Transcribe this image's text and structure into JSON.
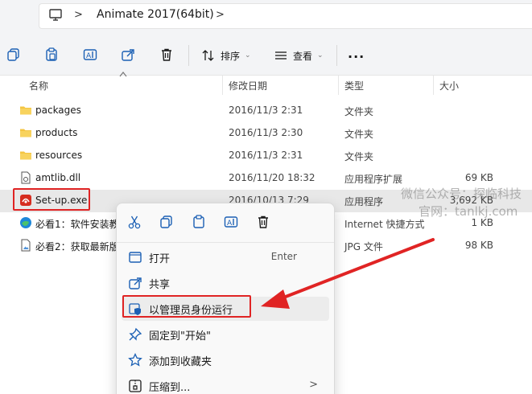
{
  "address": {
    "breadcrumb": "Animate 2017(64bit)",
    "separator": ">"
  },
  "toolbar": {
    "sort_label": "排序",
    "view_label": "查看",
    "more_label": "..."
  },
  "columns": {
    "name": "名称",
    "date": "修改日期",
    "type": "类型",
    "size": "大小"
  },
  "files": [
    {
      "name": "packages",
      "date": "2016/11/3 2:31",
      "type": "文件夹",
      "size": "",
      "icon": "folder-icon"
    },
    {
      "name": "products",
      "date": "2016/11/3 2:30",
      "type": "文件夹",
      "size": "",
      "icon": "folder-icon"
    },
    {
      "name": "resources",
      "date": "2016/11/3 2:31",
      "type": "文件夹",
      "size": "",
      "icon": "folder-icon"
    },
    {
      "name": "amtlib.dll",
      "date": "2016/11/20 18:32",
      "type": "应用程序扩展",
      "size": "69 KB",
      "icon": "dll-file-icon"
    },
    {
      "name": "Set-up.exe",
      "date": "2016/10/13 7:29",
      "type": "应用程序",
      "size": "3,692 KB",
      "icon": "setup-exe-icon"
    },
    {
      "name": "必看1：软件安装教",
      "date": "",
      "type": "Internet 快捷方式",
      "size": "1 KB",
      "icon": "edge-shortcut-icon"
    },
    {
      "name": "必看2：获取最新版",
      "date": "",
      "type": "JPG 文件",
      "size": "98 KB",
      "icon": "image-file-icon"
    }
  ],
  "watermark": {
    "line1": "微信公众号：探临科技",
    "line2": "官网：tanlkj.com"
  },
  "context_menu": {
    "items": [
      {
        "label": "打开",
        "shortcut": "Enter",
        "icon": "open-icon"
      },
      {
        "label": "共享",
        "shortcut": "",
        "icon": "share-icon"
      },
      {
        "label": "以管理员身份运行",
        "shortcut": "",
        "icon": "admin-shield-icon"
      },
      {
        "label": "固定到\"开始\"",
        "shortcut": "",
        "icon": "pin-icon"
      },
      {
        "label": "添加到收藏夹",
        "shortcut": "",
        "icon": "star-icon"
      },
      {
        "label": "压缩到...",
        "shortcut": "",
        "icon": "zip-icon",
        "submenu_arrow": ">"
      }
    ]
  },
  "colors": {
    "highlight": "#e02424",
    "selection": "#e8e8e8",
    "folder": "#f4c542",
    "accent": "#1a5fb4"
  }
}
